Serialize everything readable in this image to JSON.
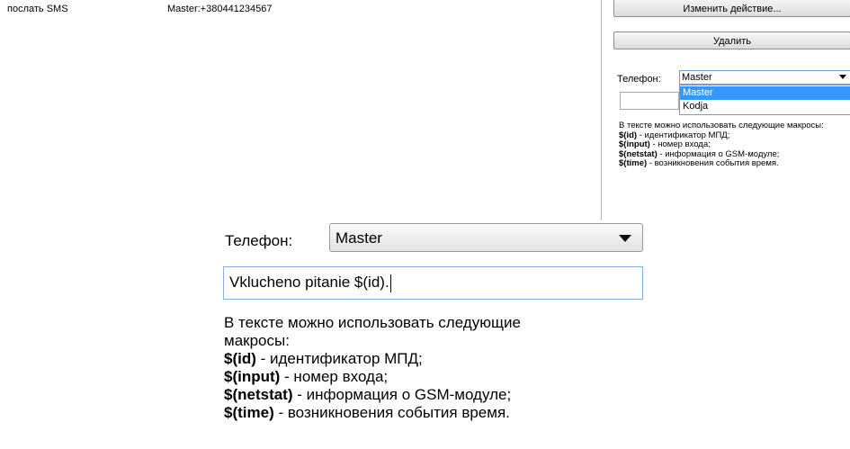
{
  "table": {
    "row": {
      "action": "послать SMS",
      "target": "Master:+380441234567"
    }
  },
  "panel": {
    "change_label": "Изменить действие...",
    "delete_label": "Удалить",
    "phone_label": "Телефон:",
    "phone_selected": "Master",
    "phone_options": [
      "Master",
      "Kodja"
    ],
    "message_value": "",
    "help": {
      "intro": "В тексте можно использовать следующие макросы:",
      "macros": [
        {
          "name": "$(id)",
          "desc": " - идентификатор МПД;"
        },
        {
          "name": "$(input)",
          "desc": " - номер входа;"
        },
        {
          "name": "$(netstat)",
          "desc": " - информация о GSM-модуле;"
        },
        {
          "name": "$(time)",
          "desc": " - возникновения события время."
        }
      ]
    }
  },
  "zoom": {
    "phone_label": "Телефон:",
    "phone_selected": "Master",
    "message_value": "Vklucheno pitanie $(id).",
    "help_line1": "В тексте можно использовать следующие",
    "help_line2": "макросы:"
  }
}
